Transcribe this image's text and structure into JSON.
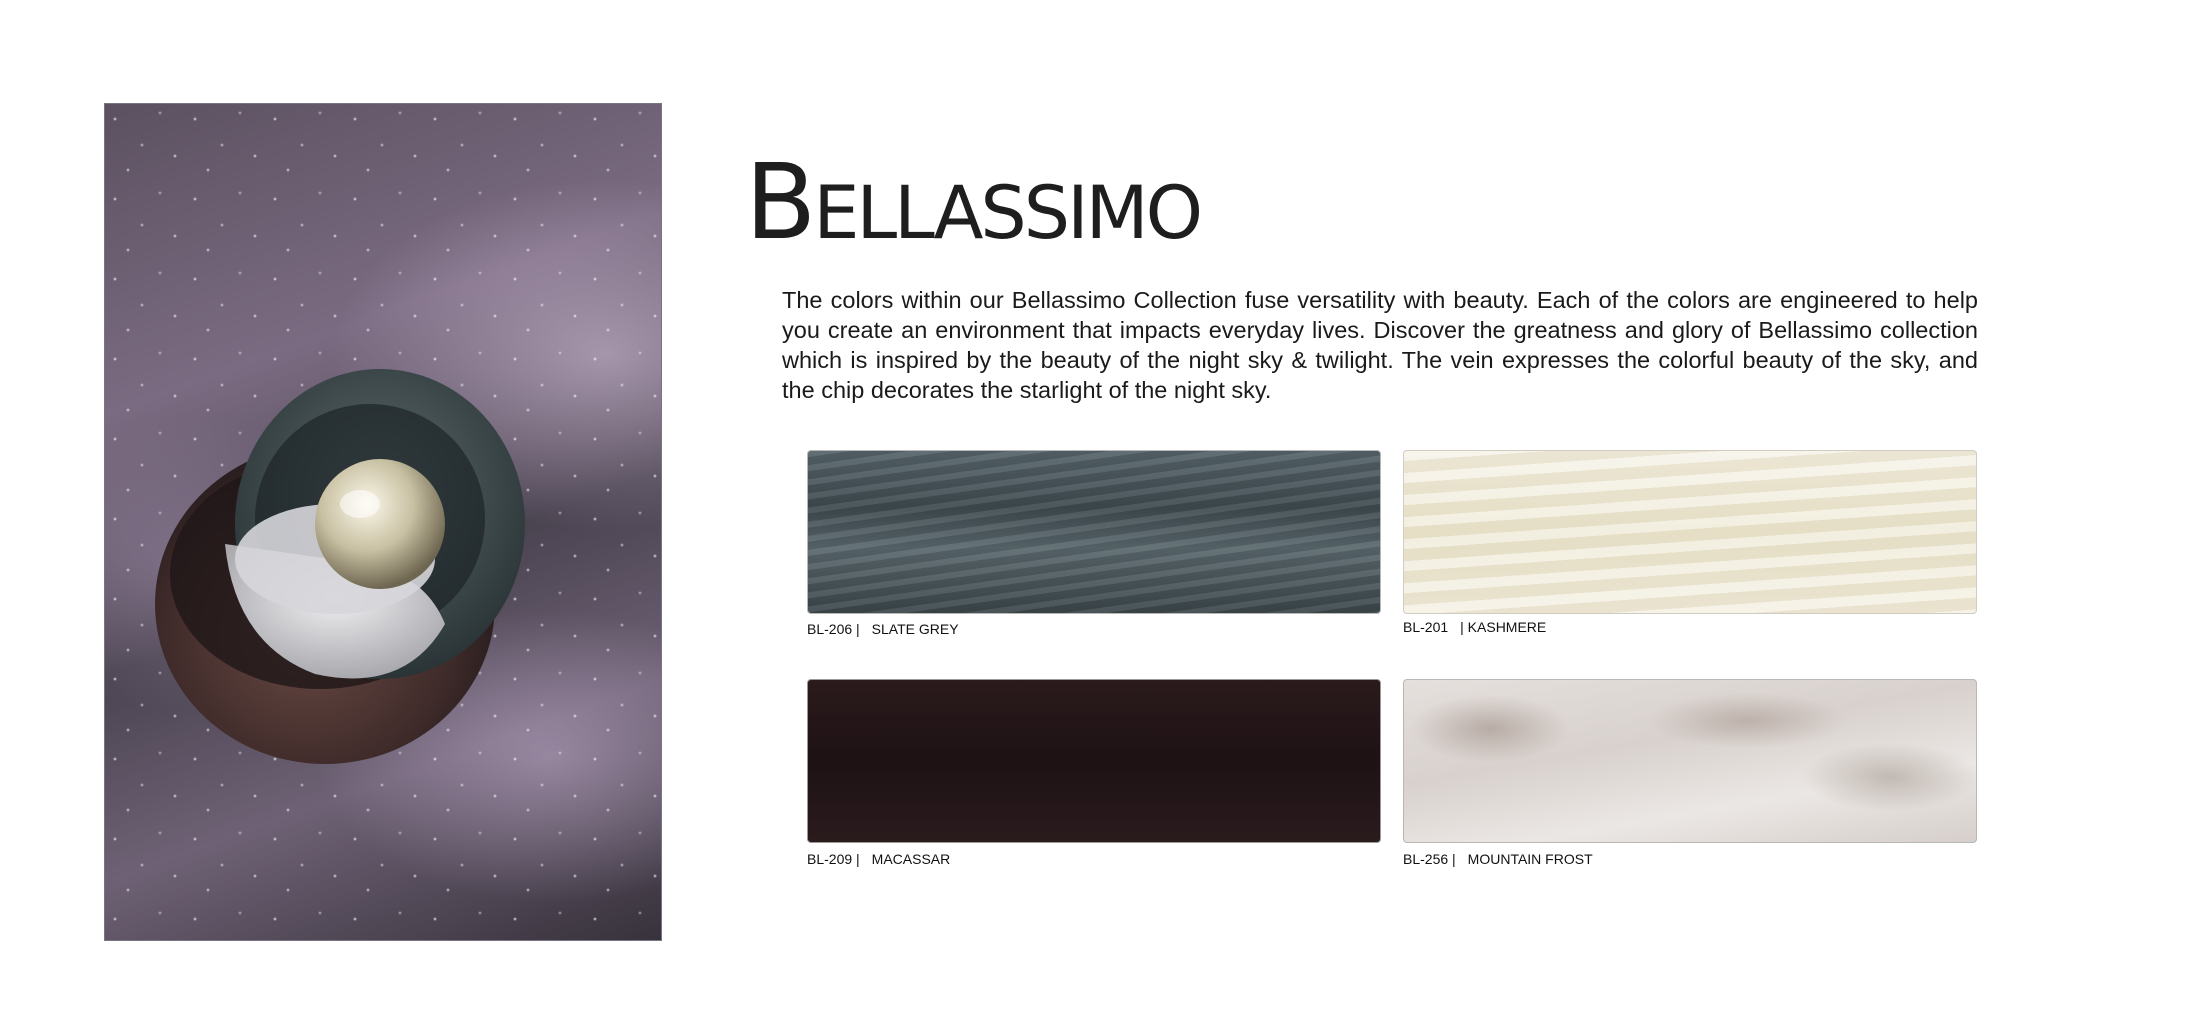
{
  "hero": {
    "image": "galaxy-orb-image"
  },
  "title": "Bellassimo",
  "intro": "The colors within our Bellassimo Collection fuse versatility with beauty. Each of the colors are engineered to help you create an environment that impacts everyday lives. Discover the greatness and glory of Bellassimo collection which is inspired by the beauty of the night sky & twilight. The vein expresses the colorful beauty of the sky, and the chip decorates the starlight of the night sky.",
  "swatches": [
    {
      "code": "BL-206 |",
      "name": "SLATE GREY",
      "color": "#4b575c"
    },
    {
      "code": "BL-201",
      "name": "| KASHMERE",
      "color": "#efe9d6"
    },
    {
      "code": "BL-209 |",
      "name": "MACASSAR",
      "color": "#231517"
    },
    {
      "code": "BL-256 |",
      "name": "MOUNTAIN FROST",
      "color": "#ddd6d2"
    }
  ]
}
